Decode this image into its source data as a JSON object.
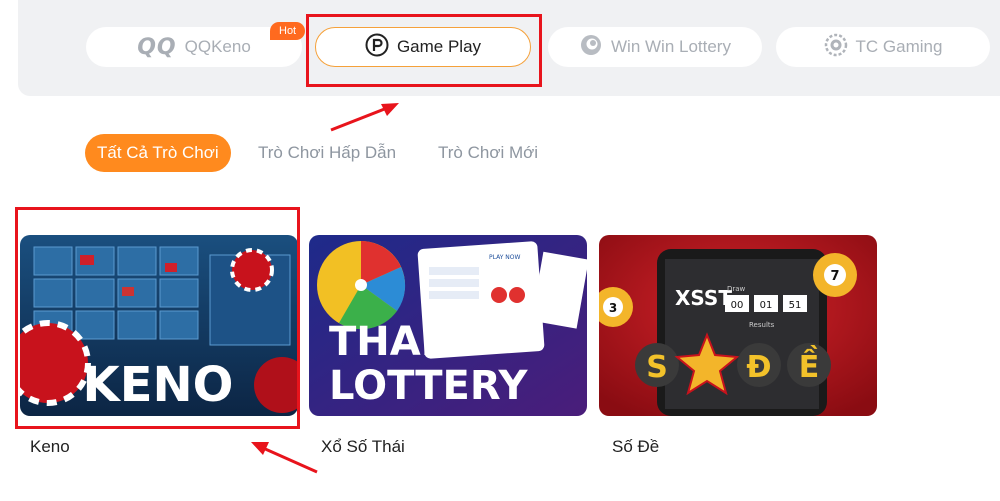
{
  "providers": [
    {
      "logo": "QQ",
      "label": "QQKeno",
      "badge": "Hot"
    },
    {
      "label": "Game Play"
    },
    {
      "label": "Win Win Lottery"
    },
    {
      "label": "TC Gaming"
    }
  ],
  "tabs": [
    {
      "label": "Tất Cả Trò Chơi"
    },
    {
      "label": "Trò Chơi Hấp Dẫn"
    },
    {
      "label": "Trò Chơi Mới"
    }
  ],
  "games": [
    {
      "title_art": "KENO",
      "label": "Keno"
    },
    {
      "title_art_1": "THAI",
      "title_art_2": "LOTTERY",
      "screen_text": "PLAY NOW",
      "label": "Xổ Số Thái"
    },
    {
      "screen_title": "XSST",
      "screen_sub": "Draw",
      "timer": [
        "00",
        "01",
        "51"
      ],
      "results_text": "Results",
      "art_letters": [
        "S",
        "Đ",
        "Ề"
      ],
      "balls": [
        "3",
        "7"
      ],
      "label": "Số Đề"
    }
  ],
  "colors": {
    "accent": "#ff8a1e",
    "highlight": "#e8141c",
    "hot_badge": "#ff6a1f"
  }
}
